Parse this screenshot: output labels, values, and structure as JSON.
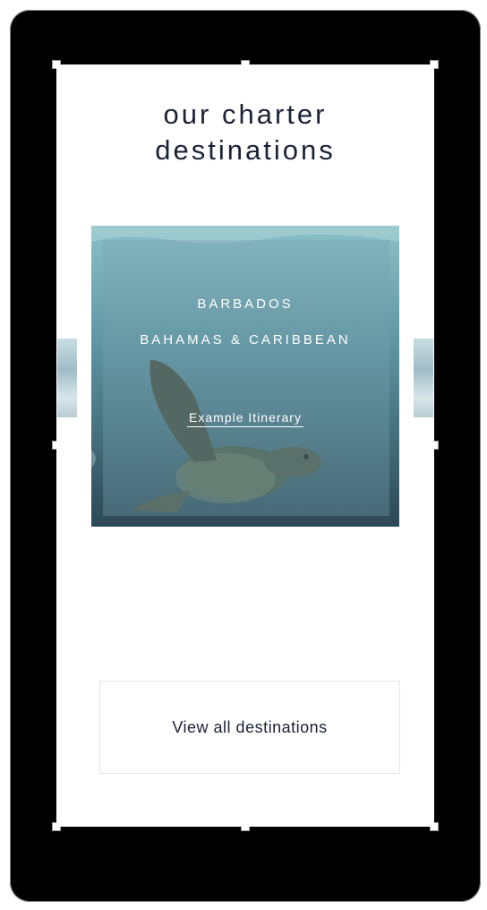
{
  "page": {
    "title_line1": "our charter",
    "title_line2": "destinations"
  },
  "carousel": {
    "active_card": {
      "destination_1": "BARBADOS",
      "destination_2": "BAHAMAS & CARIBBEAN",
      "link_label": "Example Itinerary",
      "image": "sea-turtle-underwater"
    }
  },
  "cta": {
    "view_all_label": "View all destinations"
  },
  "colors": {
    "frame": "#000000",
    "heading_text": "#1b2236",
    "card_overlay_text": "#ffffff"
  }
}
